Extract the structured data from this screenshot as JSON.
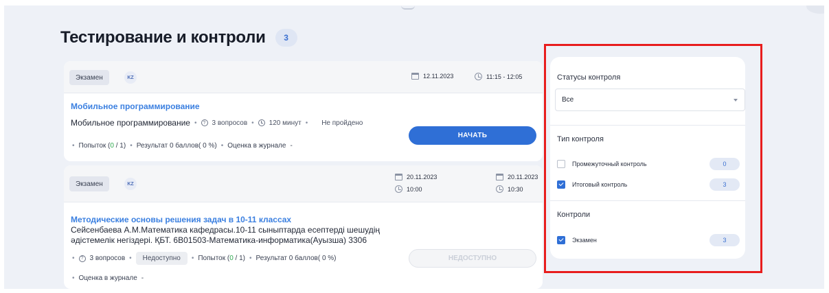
{
  "page": {
    "title": "Тестирование и контроли",
    "count": "3"
  },
  "cards": [
    {
      "exam_tag": "Экзамен",
      "lang": "KZ",
      "date": "12.11.2023",
      "time": "11:15 - 12:05",
      "course_title": "Мобильное программирование",
      "subtitle": "Мобильное программирование",
      "questions": "3 вопросов",
      "duration": "120 минут",
      "status": "Не пройдено",
      "attempts_label": "Попыток (",
      "attempts_used": "0",
      "attempts_total": " / 1)",
      "result": "Результат 0 баллов( 0 %)",
      "journal": "Оценка в журнале",
      "journal_value": "-",
      "button": "НАЧАТЬ"
    },
    {
      "exam_tag": "Экзамен",
      "lang": "KZ",
      "start_date": "20.11.2023",
      "start_time": "10:00",
      "end_date": "20.11.2023",
      "end_time": "10:30",
      "course_title": "Методические основы решения задач в 10-11 классах",
      "description": "Сейсенбаева А.М.Математика кафедрасы.10-11 сыныптарда есептерді шешудің әдістемелік негіздері. ҚБТ. 6B01503-Математика-информатика(Ауызша) 3306",
      "questions": "3 вопросов",
      "availability": "Недоступно",
      "attempts_label": "Попыток (",
      "attempts_used": "0",
      "attempts_total": " / 1)",
      "result": "Результат 0 баллов( 0 %)",
      "journal": "Оценка в журнале",
      "journal_value": "-",
      "button": "НЕДОСТУПНО"
    }
  ],
  "filters": {
    "status_label": "Статусы контроля",
    "status_value": "Все",
    "type_label": "Тип контроля",
    "types": [
      {
        "label": "Промежуточный контроль",
        "count": "0",
        "checked": false
      },
      {
        "label": "Итоговый контроль",
        "count": "3",
        "checked": true
      }
    ],
    "controls_label": "Контроли",
    "controls": [
      {
        "label": "Экзамен",
        "count": "3",
        "checked": true
      }
    ]
  },
  "colors": {
    "accent": "#2f6fd6",
    "link": "#3a7fe0",
    "success": "#2fa84f",
    "highlight_frame": "#e81d1d"
  }
}
